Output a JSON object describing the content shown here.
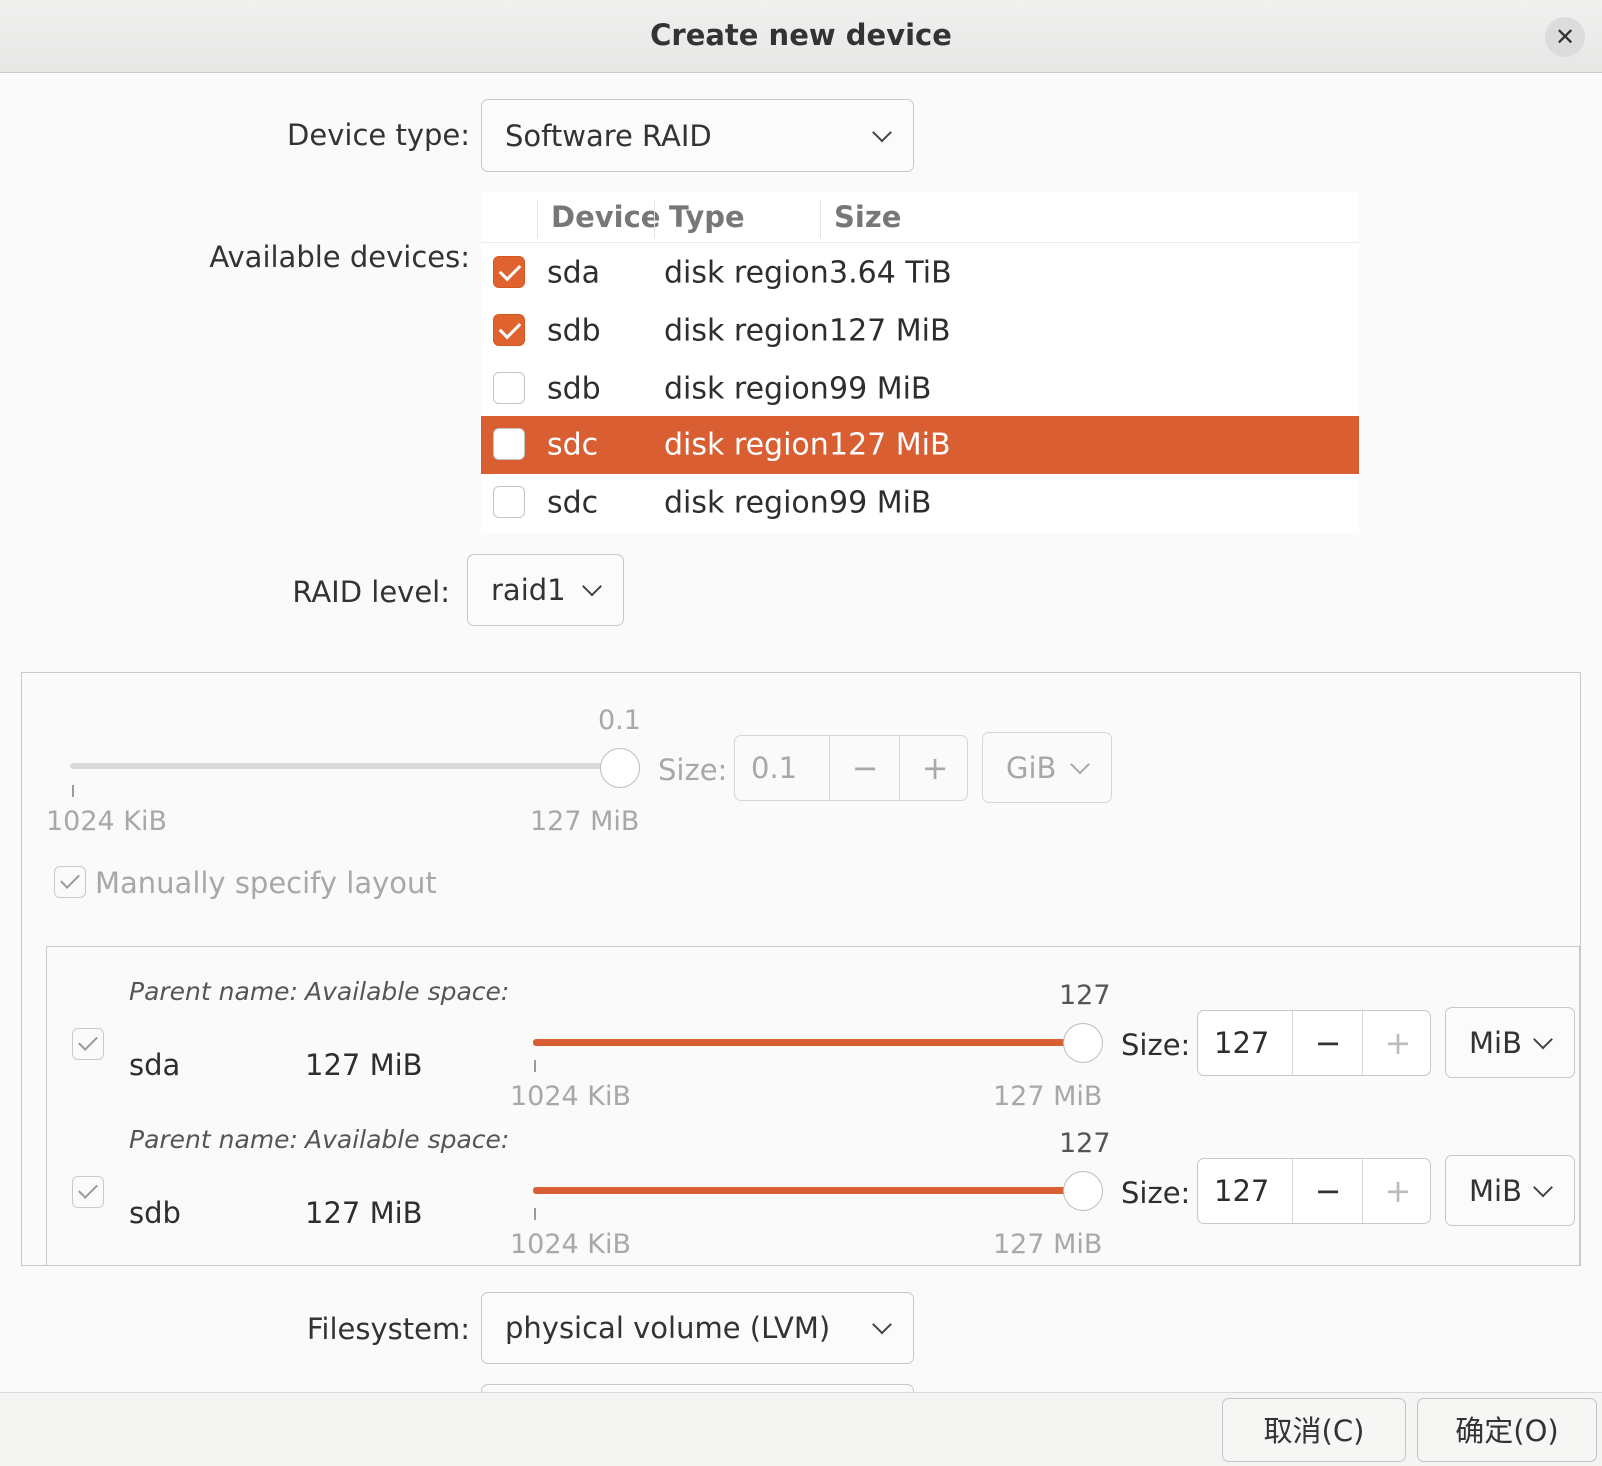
{
  "window": {
    "title": "Create new device",
    "close_icon": "close-icon"
  },
  "device_type": {
    "label": "Device type:",
    "value": "Software RAID"
  },
  "available_devices": {
    "label": "Available devices:",
    "columns": [
      "Device",
      "Type",
      "Size"
    ],
    "rows": [
      {
        "device": "sda",
        "type": "disk region",
        "size": "3.64 TiB",
        "checked": true,
        "selected": false
      },
      {
        "device": "sdb",
        "type": "disk region",
        "size": "127 MiB",
        "checked": true,
        "selected": false
      },
      {
        "device": "sdb",
        "type": "disk region",
        "size": "99 MiB",
        "checked": false,
        "selected": false
      },
      {
        "device": "sdc",
        "type": "disk region",
        "size": "127 MiB",
        "checked": false,
        "selected": true
      },
      {
        "device": "sdc",
        "type": "disk region",
        "size": "99 MiB",
        "checked": false,
        "selected": false
      }
    ]
  },
  "raid_level": {
    "label": "RAID level:",
    "value": "raid1"
  },
  "size_section": {
    "slider_value": "0.1",
    "min_label": "1024 KiB",
    "max_label": "127 MiB",
    "size_label": "Size:",
    "size_value": "0.1",
    "unit": "GiB",
    "minus": "−",
    "plus": "+"
  },
  "manual_layout": {
    "label": "Manually specify layout",
    "checked": true
  },
  "parents": [
    {
      "parent_name_label": "Parent name:",
      "available_label": "Available space:",
      "name": "sda",
      "available": "127 MiB",
      "slider_value": "127",
      "min_label": "1024 KiB",
      "max_label": "127 MiB",
      "size_label": "Size:",
      "size_value": "127",
      "unit": "MiB",
      "minus": "−",
      "plus": "+",
      "checked": true
    },
    {
      "parent_name_label": "Parent name:",
      "available_label": "Available space:",
      "name": "sdb",
      "available": "127 MiB",
      "slider_value": "127",
      "min_label": "1024 KiB",
      "max_label": "127 MiB",
      "size_label": "Size:",
      "size_value": "127",
      "unit": "MiB",
      "minus": "−",
      "plus": "+",
      "checked": true
    }
  ],
  "filesystem": {
    "label": "Filesystem:",
    "value": "physical volume (LVM)"
  },
  "buttons": {
    "cancel": "取消(C)",
    "ok": "确定(O)"
  },
  "colors": {
    "accent": "#d95f33",
    "background": "#fafafa"
  }
}
